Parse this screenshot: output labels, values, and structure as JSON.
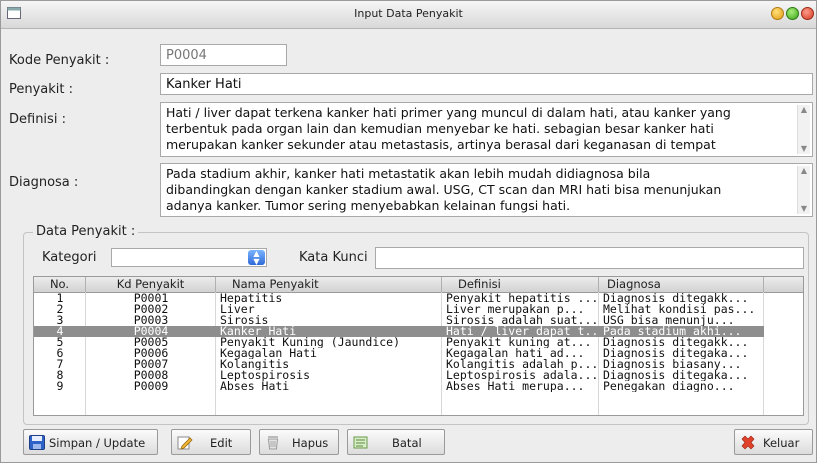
{
  "window": {
    "title": "Input Data Penyakit"
  },
  "form": {
    "kode_label": "Kode Penyakit :",
    "kode_value": "P0004",
    "penyakit_label": "Penyakit :",
    "penyakit_value": "Kanker Hati",
    "definisi_label": "Definisi :",
    "definisi_lines": [
      "Hati / liver dapat terkena kanker hati primer yang muncul di dalam hati, atau kanker yang",
      "terbentuk pada organ lain dan kemudian menyebar ke hati. sebagian besar kanker hati",
      "merupakan kanker sekunder atau metastasis, artinya berasal dari keganasan di tempat"
    ],
    "diagnosa_label": "Diagnosa :",
    "diagnosa_lines": [
      "Pada stadium akhir, kanker hati metastatik akan lebih mudah didiagnosa bila",
      "dibandingkan dengan kanker stadium awal. USG, CT scan dan MRI hati bisa menunjukan",
      "adanya kanker. Tumor sering menyebabkan kelainan fungsi hati."
    ]
  },
  "data_group": {
    "title": "Data Penyakit :",
    "kategori_label": "Kategori",
    "kategori_value": "",
    "kata_kunci_label": "Kata Kunci",
    "kata_kunci_value": ""
  },
  "table": {
    "columns": [
      "No.",
      "Kd Penyakit",
      "Nama Penyakit",
      "Definisi",
      "Diagnosa"
    ],
    "selected_row": 3,
    "rows": [
      [
        "1",
        "P0001",
        "Hepatitis",
        "Penyakit hepatitis ...",
        "Diagnosis ditegakk..."
      ],
      [
        "2",
        "P0002",
        "Liver",
        "Liver merupakan p...",
        "Melihat kondisi pas..."
      ],
      [
        "3",
        "P0003",
        "Sirosis",
        "Sirosis adalah suat...",
        "USG bisa menunju..."
      ],
      [
        "4",
        "P0004",
        "Kanker Hati",
        "Hati / liver dapat t...",
        "Pada stadium akhi..."
      ],
      [
        "5",
        "P0005",
        "Penyakit Kuning (Jaundice)",
        "Penyakit kuning at...",
        "Diagnosis ditegakk..."
      ],
      [
        "6",
        "P0006",
        "Kegagalan Hati",
        "Kegagalan hati ad...",
        "Diagnosis ditegaka..."
      ],
      [
        "7",
        "P0007",
        "Kolangitis",
        "Kolangitis adalah p...",
        "Diagnosis biasany..."
      ],
      [
        "8",
        "P0008",
        "Leptospirosis",
        "Leptospirosis adala...",
        "Diagnosis ditegaka..."
      ],
      [
        "9",
        "P0009",
        "Abses Hati",
        "Abses Hati merupa...",
        "Penegakan diagno..."
      ]
    ]
  },
  "buttons": {
    "simpan": "Simpan / Update",
    "edit": "Edit",
    "hapus": "Hapus",
    "batal": "Batal",
    "keluar": "Keluar"
  },
  "icons": {
    "window": "window-icon",
    "simpan": "floppy-disk-icon",
    "edit": "pencil-icon",
    "hapus": "trash-icon",
    "batal": "cancel-icon",
    "keluar": "exit-x-icon"
  }
}
